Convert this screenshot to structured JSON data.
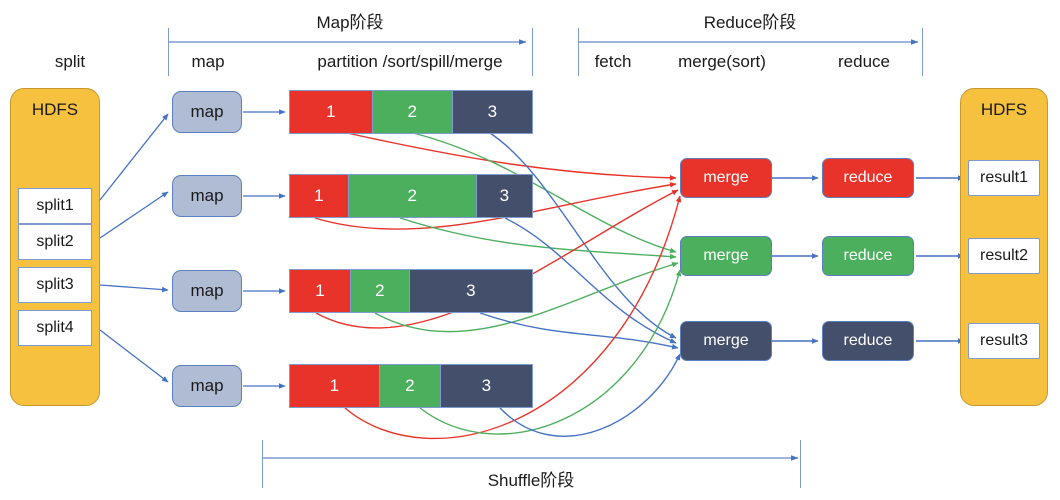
{
  "diagram": {
    "title": "MapReduce Map / Shuffle / Reduce dataflow",
    "colors": {
      "red": "#E8332A",
      "green": "#4CAF5E",
      "slate": "#44506B",
      "orange": "#F5C13F",
      "mapbox": "#AFBCD4",
      "arrow": "#4472C4",
      "bracket": "#7e9cd0"
    }
  },
  "phases": {
    "map": {
      "label": "Map阶段"
    },
    "reduce": {
      "label": "Reduce阶段"
    },
    "shuffle": {
      "label": "Shuffle阶段"
    }
  },
  "columns": [
    {
      "key": "split",
      "label": "split"
    },
    {
      "key": "map",
      "label": "map"
    },
    {
      "key": "partition",
      "label": "partition /sort/spill/merge"
    },
    {
      "key": "fetch",
      "label": "fetch"
    },
    {
      "key": "mergesort",
      "label": "merge(sort)"
    },
    {
      "key": "reduce",
      "label": "reduce"
    }
  ],
  "input_store": {
    "name": "HDFS",
    "items": [
      {
        "label": "split1"
      },
      {
        "label": "split2"
      },
      {
        "label": "split3"
      },
      {
        "label": "split4"
      }
    ]
  },
  "output_store": {
    "name": "HDFS",
    "items": [
      {
        "label": "result1"
      },
      {
        "label": "result2"
      },
      {
        "label": "result3"
      }
    ]
  },
  "mappers": [
    {
      "label": "map"
    },
    {
      "label": "map"
    },
    {
      "label": "map"
    },
    {
      "label": "map"
    }
  ],
  "partition_bars": [
    {
      "segments": [
        {
          "label": "1",
          "color": "#E8332A",
          "pct": 34
        },
        {
          "label": "2",
          "color": "#4CAF5E",
          "pct": 33
        },
        {
          "label": "3",
          "color": "#44506B",
          "pct": 33
        }
      ]
    },
    {
      "segments": [
        {
          "label": "1",
          "color": "#E8332A",
          "pct": 24
        },
        {
          "label": "2",
          "color": "#4CAF5E",
          "pct": 53
        },
        {
          "label": "3",
          "color": "#44506B",
          "pct": 23
        }
      ]
    },
    {
      "segments": [
        {
          "label": "1",
          "color": "#E8332A",
          "pct": 25
        },
        {
          "label": "2",
          "color": "#4CAF5E",
          "pct": 24
        },
        {
          "label": "3",
          "color": "#44506B",
          "pct": 51
        }
      ]
    },
    {
      "segments": [
        {
          "label": "1",
          "color": "#E8332A",
          "pct": 37
        },
        {
          "label": "2",
          "color": "#4CAF5E",
          "pct": 25
        },
        {
          "label": "3",
          "color": "#44506B",
          "pct": 38
        }
      ]
    }
  ],
  "mergers": [
    {
      "label": "merge",
      "color": "#E8332A"
    },
    {
      "label": "merge",
      "color": "#4CAF5E"
    },
    {
      "label": "merge",
      "color": "#44506B"
    }
  ],
  "reducers": [
    {
      "label": "reduce",
      "color": "#E8332A"
    },
    {
      "label": "reduce",
      "color": "#4CAF5E"
    },
    {
      "label": "reduce",
      "color": "#44506B"
    }
  ]
}
